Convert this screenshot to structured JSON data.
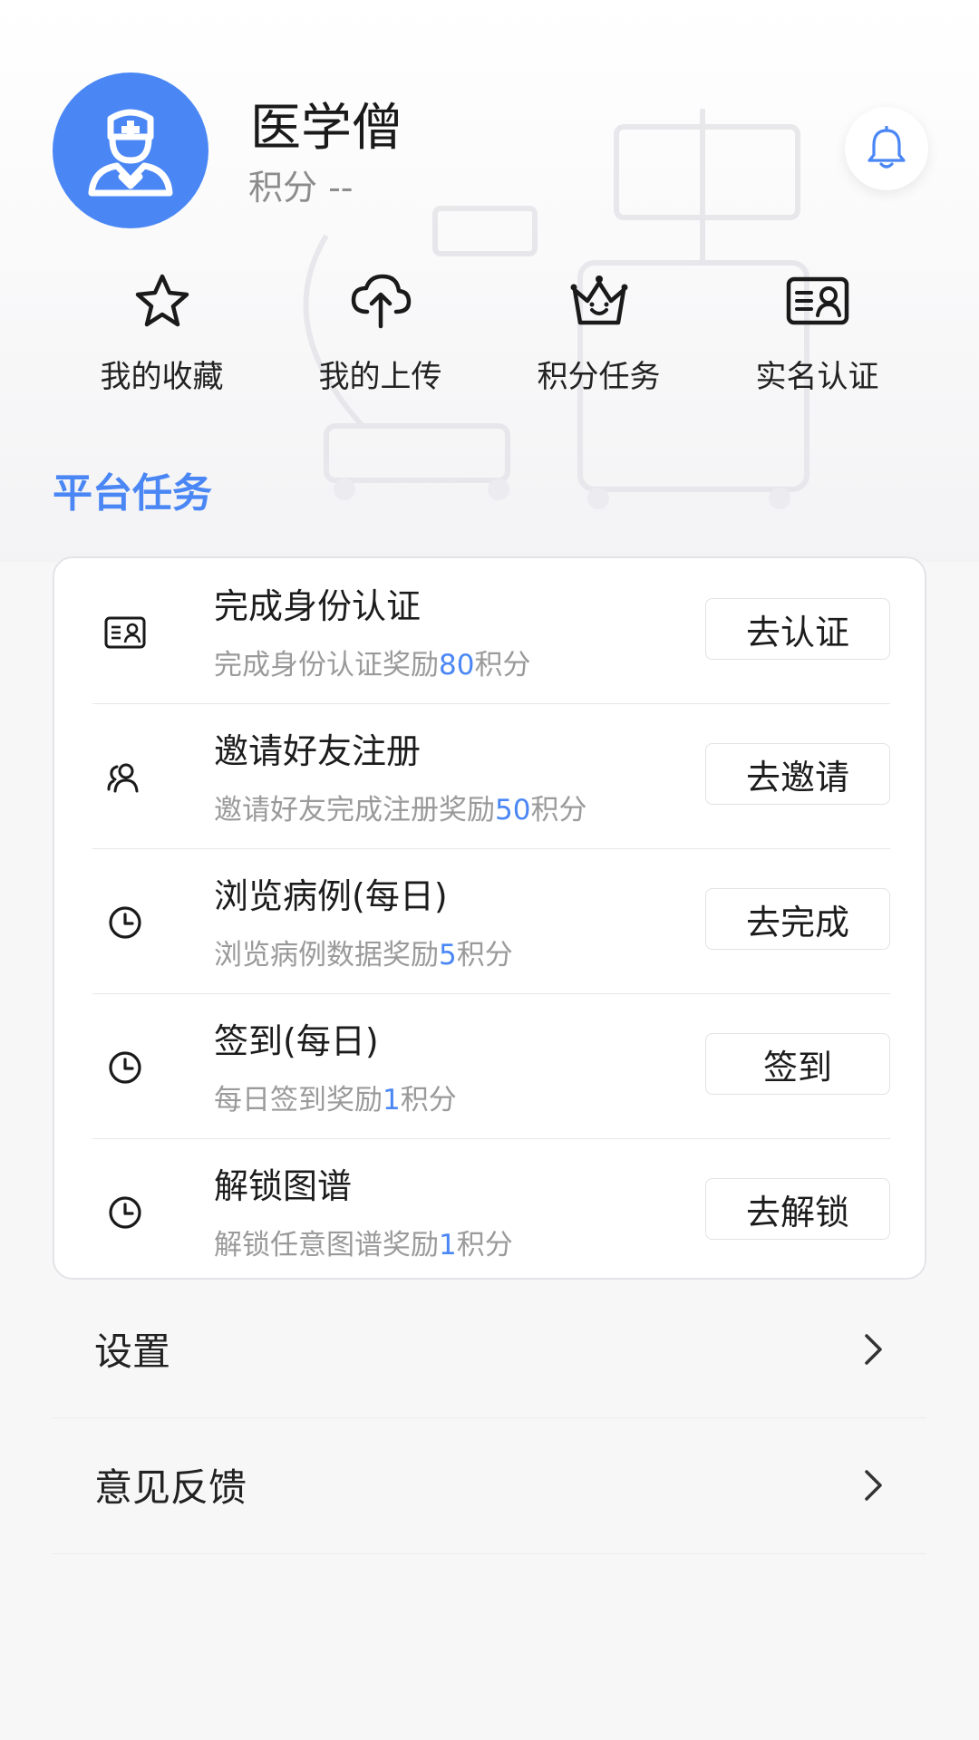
{
  "profile": {
    "name": "医学僧",
    "points_label": "积分 --"
  },
  "quick_nav": [
    {
      "label": "我的收藏",
      "icon": "star-icon"
    },
    {
      "label": "我的上传",
      "icon": "cloud-upload-icon"
    },
    {
      "label": "积分任务",
      "icon": "crown-icon"
    },
    {
      "label": "实名认证",
      "icon": "id-card-icon"
    }
  ],
  "section": {
    "title": "平台任务"
  },
  "tasks": [
    {
      "title": "完成身份认证",
      "desc_prefix": "完成身份认证奖励",
      "reward": "80",
      "desc_suffix": "积分",
      "button": "去认证",
      "icon": "id-card-icon"
    },
    {
      "title": "邀请好友注册",
      "desc_prefix": "邀请好友完成注册奖励",
      "reward": "50",
      "desc_suffix": "积分",
      "button": "去邀请",
      "icon": "users-icon"
    },
    {
      "title": "浏览病例(每日)",
      "desc_prefix": "浏览病例数据奖励",
      "reward": "5",
      "desc_suffix": "积分",
      "button": "去完成",
      "icon": "clock-icon"
    },
    {
      "title": "签到(每日)",
      "desc_prefix": "每日签到奖励",
      "reward": "1",
      "desc_suffix": "积分",
      "button": "签到",
      "icon": "clock-icon"
    },
    {
      "title": "解锁图谱",
      "desc_prefix": "解锁任意图谱奖励",
      "reward": "1",
      "desc_suffix": "积分",
      "button": "去解锁",
      "icon": "clock-icon"
    }
  ],
  "menu": [
    {
      "label": "设置"
    },
    {
      "label": "意见反馈"
    }
  ],
  "colors": {
    "accent": "#4a87f5",
    "muted_text": "#9a9a9a"
  }
}
